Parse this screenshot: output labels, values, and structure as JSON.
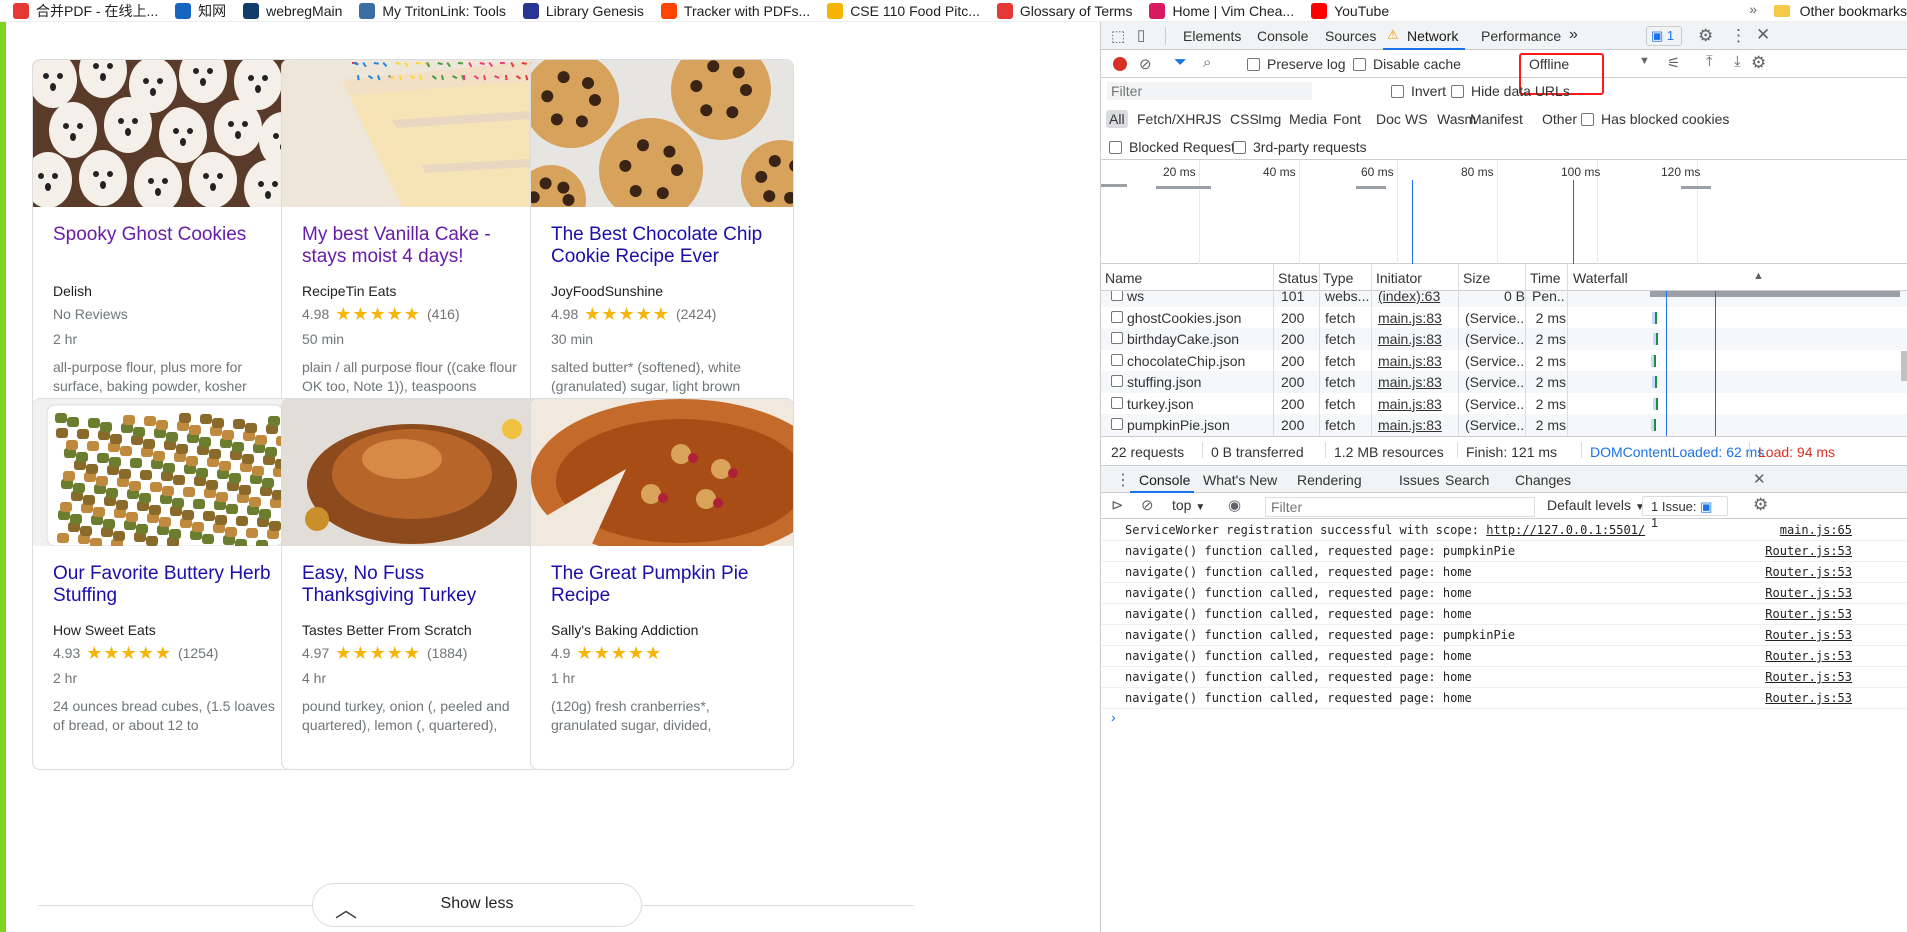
{
  "bookmarks": {
    "items": [
      {
        "label": "合并PDF - 在线上...",
        "icon": "pdf-merge-icon",
        "color": "#e53935"
      },
      {
        "label": "知网",
        "icon": "cnki-icon",
        "color": "#1565c0"
      },
      {
        "label": "webregMain",
        "icon": "ucsd-icon",
        "color": "#123d6a"
      },
      {
        "label": "My TritonLink: Tools",
        "icon": "tritonlink-icon",
        "color": "#3b6ea5"
      },
      {
        "label": "Library Genesis",
        "icon": "libgen-icon",
        "color": "#283593"
      },
      {
        "label": "Tracker with PDFs...",
        "icon": "reddit-icon",
        "color": "#ff4500"
      },
      {
        "label": "CSE 110 Food Pitc...",
        "icon": "slides-icon",
        "color": "#f4b400"
      },
      {
        "label": "Glossary of Terms",
        "icon": "glossary-icon",
        "color": "#e53935"
      },
      {
        "label": "Home | Vim Chea...",
        "icon": "vim-icon",
        "color": "#d81b60"
      },
      {
        "label": "YouTube",
        "icon": "youtube-icon",
        "color": "#ff0000"
      }
    ],
    "more": "»",
    "other": "Other bookmarks"
  },
  "recipes": [
    {
      "title": "Spooky Ghost Cookies",
      "visited": true,
      "org": "Delish",
      "rating": "",
      "stars": "",
      "count": "",
      "no_reviews": "No Reviews",
      "time": "2 hr",
      "ingredients": "all-purpose flour, plus more for surface, baking powder, kosher",
      "img": "ghost"
    },
    {
      "title": "My best Vanilla Cake - stays moist 4 days!",
      "visited": true,
      "org": "RecipeTin Eats",
      "rating": "4.98",
      "stars": "★★★★★",
      "count": "(416)",
      "no_reviews": "",
      "time": "50 min",
      "ingredients": "plain / all purpose flour ((cake flour OK too, Note 1)), teaspoons",
      "img": "cake"
    },
    {
      "title": "The Best Chocolate Chip Cookie Recipe Ever",
      "visited": false,
      "org": "JoyFoodSunshine",
      "rating": "4.98",
      "stars": "★★★★★",
      "count": "(2424)",
      "no_reviews": "",
      "time": "30 min",
      "ingredients": "salted butter* (softened), white (granulated) sugar, light brown",
      "img": "cookie"
    },
    {
      "title": "Our Favorite Buttery Herb Stuffing",
      "visited": false,
      "org": "How Sweet Eats",
      "rating": "4.93",
      "stars": "★★★★★",
      "count": "(1254)",
      "no_reviews": "",
      "time": "2 hr",
      "ingredients": "24 ounces bread cubes, (1.5 loaves of bread, or about 12 to",
      "img": "stuffing"
    },
    {
      "title": "Easy, No Fuss Thanksgiving Turkey",
      "visited": false,
      "org": "Tastes Better From Scratch",
      "rating": "4.97",
      "stars": "★★★★★",
      "count": "(1884)",
      "no_reviews": "",
      "time": "4 hr",
      "ingredients": "pound turkey, onion (, peeled and quartered), lemon (, quartered),",
      "img": "turkey"
    },
    {
      "title": "The Great Pumpkin Pie Recipe",
      "visited": false,
      "org": "Sally's Baking Addiction",
      "rating": "4.9",
      "stars": "★★★★★",
      "count": "",
      "no_reviews": "",
      "time": "1 hr",
      "ingredients": "(120g) fresh cranberries*, granulated sugar, divided,",
      "img": "pie"
    }
  ],
  "show_less": "Show less",
  "devtools": {
    "tabs": [
      "Elements",
      "Console",
      "Sources",
      "Network",
      "Performance"
    ],
    "active_tab": "Network",
    "more_tabs": "»",
    "issue_badge": "1",
    "toolbar": {
      "preserve_log": "Preserve log",
      "disable_cache": "Disable cache",
      "throttle": "Offline"
    },
    "filter": {
      "placeholder": "Filter",
      "invert": "Invert",
      "hide_data_urls": "Hide data URLs"
    },
    "types": [
      "All",
      "Fetch/XHR",
      "JS",
      "CSS",
      "Img",
      "Media",
      "Font",
      "Doc",
      "WS",
      "Wasm",
      "Manifest",
      "Other"
    ],
    "has_blocked_cookies": "Has blocked cookies",
    "blocked_requests": "Blocked Requests",
    "third_party": "3rd-party requests",
    "overview_labels": [
      "20 ms",
      "40 ms",
      "60 ms",
      "80 ms",
      "100 ms",
      "120 ms"
    ],
    "columns": [
      "Name",
      "Status",
      "Type",
      "Initiator",
      "Size",
      "Time",
      "Waterfall"
    ],
    "requests": [
      {
        "name": "ws",
        "status": "101",
        "type": "webs...",
        "initiator": "(index):63",
        "size": "0 B",
        "time": "Pen..."
      },
      {
        "name": "ghostCookies.json",
        "status": "200",
        "type": "fetch",
        "initiator": "main.js:83",
        "size": "(Service...",
        "time": "2 ms"
      },
      {
        "name": "birthdayCake.json",
        "status": "200",
        "type": "fetch",
        "initiator": "main.js:83",
        "size": "(Service...",
        "time": "2 ms"
      },
      {
        "name": "chocolateChip.json",
        "status": "200",
        "type": "fetch",
        "initiator": "main.js:83",
        "size": "(Service...",
        "time": "2 ms"
      },
      {
        "name": "stuffing.json",
        "status": "200",
        "type": "fetch",
        "initiator": "main.js:83",
        "size": "(Service...",
        "time": "2 ms"
      },
      {
        "name": "turkey.json",
        "status": "200",
        "type": "fetch",
        "initiator": "main.js:83",
        "size": "(Service...",
        "time": "2 ms"
      },
      {
        "name": "pumpkinPie.json",
        "status": "200",
        "type": "fetch",
        "initiator": "main.js:83",
        "size": "(Service...",
        "time": "2 ms"
      }
    ],
    "summary": {
      "requests": "22 requests",
      "transferred": "0 B transferred",
      "resources": "1.2 MB resources",
      "finish": "Finish: 121 ms",
      "dom": "DOMContentLoaded: 62 ms",
      "load": "Load: 94 ms"
    },
    "drawer_tabs": [
      "Console",
      "What's New",
      "Rendering",
      "Issues",
      "Search",
      "Changes"
    ],
    "console": {
      "context": "top",
      "filter_placeholder": "Filter",
      "levels": "Default levels",
      "issues": "1 Issue:",
      "issues_count": "1",
      "logs": [
        {
          "msg": "ServiceWorker registration successful with scope: ",
          "url": "http://127.0.0.1:5501/",
          "src": "main.js:65"
        },
        {
          "msg": "navigate() function called, requested page: pumpkinPie",
          "url": "",
          "src": "Router.js:53"
        },
        {
          "msg": "navigate() function called, requested page: home",
          "url": "",
          "src": "Router.js:53"
        },
        {
          "msg": "navigate() function called, requested page: home",
          "url": "",
          "src": "Router.js:53"
        },
        {
          "msg": "navigate() function called, requested page: home",
          "url": "",
          "src": "Router.js:53"
        },
        {
          "msg": "navigate() function called, requested page: pumpkinPie",
          "url": "",
          "src": "Router.js:53"
        },
        {
          "msg": "navigate() function called, requested page: home",
          "url": "",
          "src": "Router.js:53"
        },
        {
          "msg": "navigate() function called, requested page: home",
          "url": "",
          "src": "Router.js:53"
        },
        {
          "msg": "navigate() function called, requested page: home",
          "url": "",
          "src": "Router.js:53"
        }
      ],
      "prompt": "›"
    }
  }
}
